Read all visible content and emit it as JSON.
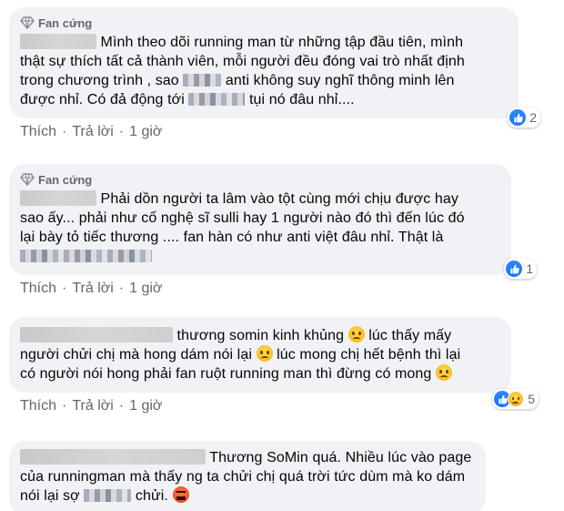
{
  "colors": {
    "bubble_bg": "#f0f2f5",
    "meta_text": "#65676b",
    "like_blue": "#1877f2"
  },
  "comments": [
    {
      "badge": "Fan cứng",
      "text_line1": "Mình theo dõi running man từ những tập đầu tiên, mình",
      "text_line2": "thật sự thích tất cả thành viên, mỗi người đều đóng vai trò nhất định",
      "text_line3a": "trong chương trình , sao",
      "text_line3b": "anti không suy nghĩ thông minh lên",
      "text_line4a": "được nhỉ. Có đả động tới",
      "text_line4b": "tụi nó đâu nhỉ....",
      "reactions": [
        "like-icon"
      ],
      "reaction_count": "2",
      "actions": {
        "like": "Thích",
        "reply": "Trả lời",
        "time": "1 giờ"
      }
    },
    {
      "badge": "Fan cứng",
      "text_line1": "Phải dồn người ta lâm vào tột cùng mới chịu được hay",
      "text_line2": "sao ấy... phải như cố nghệ sĩ sulli hay 1 người nào đó thì đến lúc đó",
      "text_line3": "lại bày tỏ tiếc thương .... fan hàn có như anti việt đâu nhỉ. Thật là",
      "reactions": [
        "like-icon"
      ],
      "reaction_count": "1",
      "actions": {
        "like": "Thích",
        "reply": "Trả lời",
        "time": "1 giờ"
      }
    },
    {
      "text_line1": "thương somin kinh khủng",
      "text_line1b": "lúc thấy mấy",
      "text_line2a": "người chửi chị mà hong dám nói lại",
      "text_line2b": "lúc mong chị hết bệnh thì lại",
      "text_line3": "có người nói hong phải fan ruột running man thì đừng có mong",
      "reactions": [
        "like-icon",
        "sad-icon"
      ],
      "reaction_count": "5",
      "actions": {
        "like": "Thích",
        "reply": "Trả lời",
        "time": "1 giờ"
      }
    },
    {
      "text_line1": "Thương SoMin quá. Nhiều lúc vào page",
      "text_line2": "của runningman mà thấy ng ta chửi chị quá trời tức dùm mà ko dám",
      "text_line3a": "nói lại sợ",
      "text_line3b": "chửi."
    }
  ]
}
